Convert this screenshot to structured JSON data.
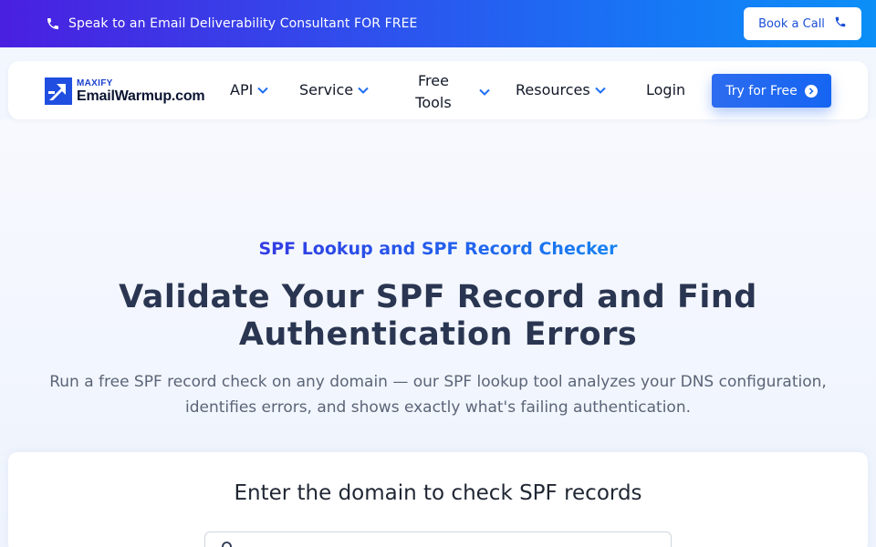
{
  "topbar": {
    "promo_text": "Speak to an Email Deliverability Consultant FOR FREE",
    "book_label": "Book a Call",
    "icon": "phone-icon",
    "gradient_colors": [
      "#4a1fe0",
      "#2d53ee",
      "#1677f5",
      "#0c8ff7"
    ]
  },
  "nav": {
    "logo_small": "MAXIFY",
    "logo_big": "EmailWarmup.com",
    "api_label": "API",
    "service_label": "Service",
    "free_tools_line1": "Free",
    "free_tools_line2": "Tools",
    "resources_label": "Resources",
    "login_label": "Login",
    "try_label": "Try for Free",
    "chevron_icon": "chevron-down-icon",
    "accent_color": "#1f6ef2"
  },
  "hero": {
    "eyebrow": "SPF Lookup and SPF Record Checker",
    "headline": "Validate Your SPF Record and Find Authentication Errors",
    "subtext": "Run a free SPF record check on any domain — our SPF lookup tool analyzes your DNS configuration, identifies errors, and shows exactly what's failing authentication."
  },
  "checker": {
    "title": "Enter the domain to check SPF records",
    "input_placeholder": "",
    "input_value": "",
    "icon": "search-icon"
  }
}
